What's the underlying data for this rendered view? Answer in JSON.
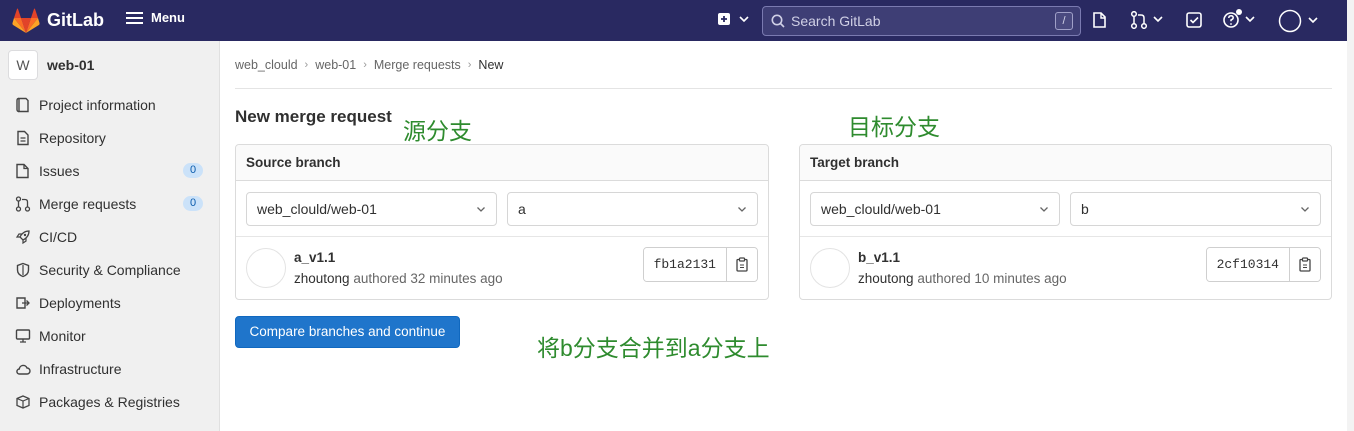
{
  "topbar": {
    "brand": "GitLab",
    "menu_label": "Menu",
    "search_placeholder": "Search GitLab",
    "search_shortcut": "/"
  },
  "sidebar": {
    "project_initial": "W",
    "project_name": "web-01",
    "items": [
      {
        "label": "Project information",
        "icon": "info-icon"
      },
      {
        "label": "Repository",
        "icon": "doc-icon"
      },
      {
        "label": "Issues",
        "icon": "issues-icon",
        "badge": "0"
      },
      {
        "label": "Merge requests",
        "icon": "merge-request-icon",
        "badge": "0"
      },
      {
        "label": "CI/CD",
        "icon": "rocket-icon"
      },
      {
        "label": "Security & Compliance",
        "icon": "shield-icon"
      },
      {
        "label": "Deployments",
        "icon": "deployments-icon"
      },
      {
        "label": "Monitor",
        "icon": "monitor-icon"
      },
      {
        "label": "Infrastructure",
        "icon": "cloud-icon"
      },
      {
        "label": "Packages & Registries",
        "icon": "package-icon"
      }
    ]
  },
  "breadcrumb": {
    "items": [
      "web_clould",
      "web-01",
      "Merge requests"
    ],
    "current": "New"
  },
  "page": {
    "title": "New merge request",
    "annotation_source": "源分支",
    "annotation_target": "目标分支",
    "annotation_note": "将b分支合并到a分支上",
    "compare_button": "Compare branches and continue"
  },
  "source": {
    "header": "Source branch",
    "project": "web_clould/web-01",
    "branch": "a",
    "commit_title": "a_v1.1",
    "author": "zhoutong",
    "authored_text": "authored 32 minutes ago",
    "sha": "fb1a2131"
  },
  "target": {
    "header": "Target branch",
    "project": "web_clould/web-01",
    "branch": "b",
    "commit_title": "b_v1.1",
    "author": "zhoutong",
    "authored_text": "authored 10 minutes ago",
    "sha": "2cf10314"
  },
  "colors": {
    "topbar": "#292961",
    "primary_button": "#1f75cb",
    "annotation": "#2e8b2e",
    "logo": "#e24329"
  }
}
